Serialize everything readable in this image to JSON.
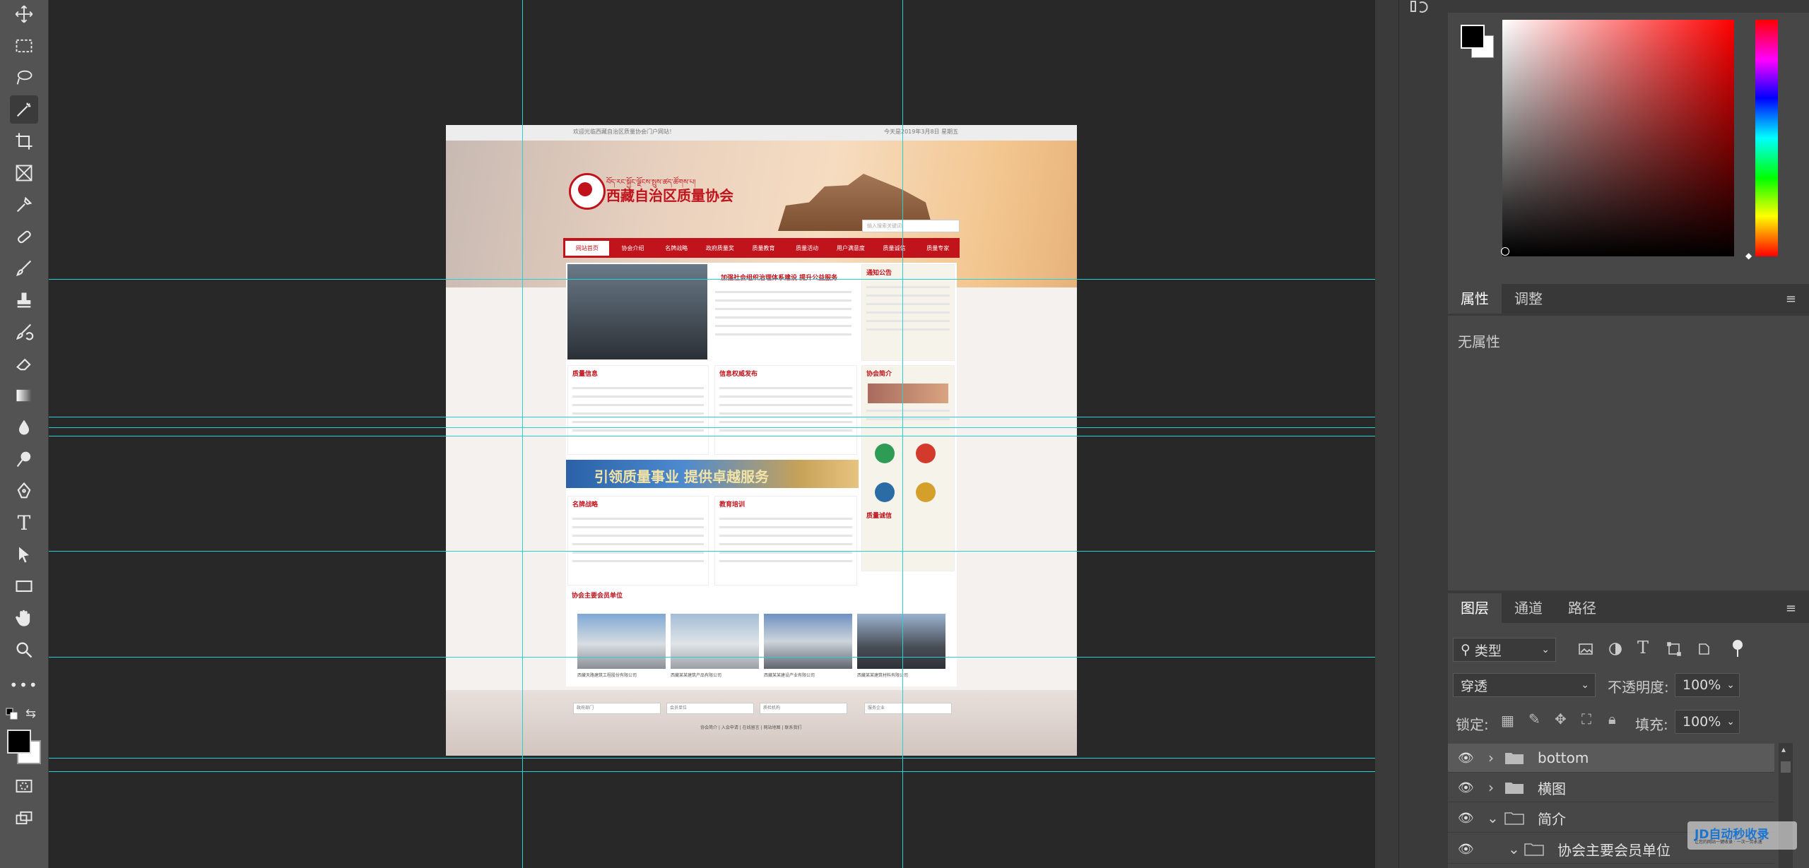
{
  "app": {
    "left_toolbar": {
      "tools": [
        "move-icon",
        "marquee-icon",
        "lasso-icon",
        "magic-wand-icon",
        "crop-icon",
        "frame-icon",
        "eyedropper-icon",
        "healing-icon",
        "brush-icon",
        "stamp-icon",
        "history-brush-icon",
        "eraser-icon",
        "gradient-icon",
        "blur-icon",
        "dodge-icon",
        "pen-icon",
        "text-icon",
        "path-select-icon",
        "rectangle-icon",
        "hand-icon",
        "zoom-icon",
        "more-icon"
      ],
      "text_tool_glyph": "T"
    }
  },
  "document": {
    "topbar_left": "欢迎光临西藏自治区质量协会门户网站！",
    "topbar_right": "今天是2019年3月8日  星期五",
    "header": {
      "subtitle": "བོད་རང་སྐྱོང་ལྗོངས་སྤུས་ཚད་ཚོགས་པ།",
      "title": "西藏自治区质量协会",
      "search_placeholder": "输入搜索关键词"
    },
    "nav": [
      "网站首页",
      "协会介绍",
      "名牌战略",
      "政府质量奖",
      "质量教育",
      "质量活动",
      "用户满意度",
      "质量诚信",
      "质量专家"
    ],
    "news_headline": "加强社会组织治理体系建设 提升公益服务",
    "sections": {
      "notice": "通知公告",
      "quality_info": "质量信息",
      "info_release": "信息权威发布",
      "association_intro": "协会简介",
      "brand_strategy": "名牌战略",
      "education": "教育培训",
      "integrity": "质量诚信",
      "members": "协会主要会员单位"
    },
    "slogan": "引领质量事业 提供卓越服务",
    "members": [
      "西藏天路建筑工程股份有限公司",
      "西藏某某建筑产品有限公司",
      "西藏某某建设产业有限公司",
      "西藏某某建筑材料有限公司"
    ],
    "footer_selects": [
      "政府部门",
      "会员单位",
      "质检机构",
      "服务企业"
    ],
    "footer_links": "协会简介 | 入会申请 | 在线留言 | 网站地图 | 联系我们"
  },
  "panels": {
    "color_panel": {
      "foreground": "#000000",
      "background": "#ffffff"
    },
    "properties": {
      "tabs": [
        "属性",
        "调整"
      ],
      "empty_text": "无属性"
    },
    "layers": {
      "tabs": [
        "图层",
        "通道",
        "路径"
      ],
      "filter_kind": "类型",
      "blend_mode": "穿透",
      "opacity_label": "不透明度:",
      "opacity_value": "100%",
      "lock_label": "锁定:",
      "fill_label": "填充:",
      "fill_value": "100%",
      "items": [
        {
          "name": "bottom",
          "expanded": false,
          "selected": true
        },
        {
          "name": "横图",
          "expanded": false,
          "selected": false
        },
        {
          "name": "简介",
          "expanded": true,
          "selected": false
        },
        {
          "name": "协会主要会员单位",
          "expanded": true,
          "selected": false
        }
      ]
    }
  },
  "watermark": {
    "title": "JD自动秒收录",
    "subtitle": "让您的网站一键收录 · 一次一劳永逸"
  }
}
